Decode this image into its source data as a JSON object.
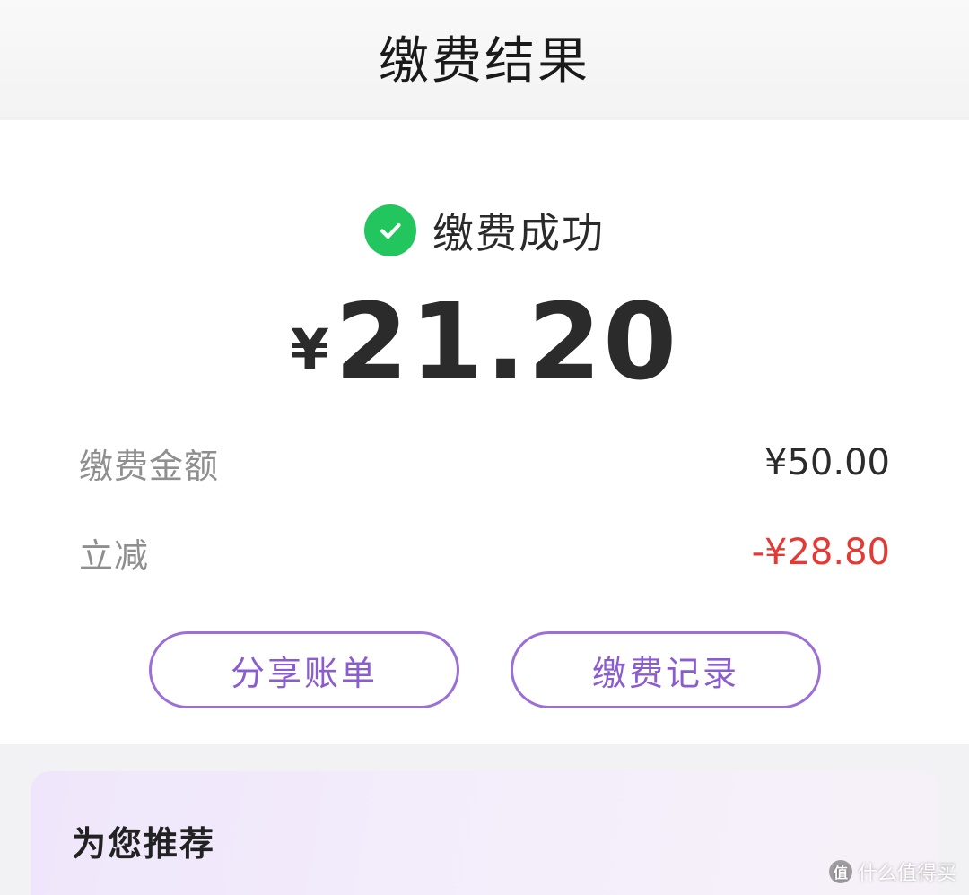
{
  "header": {
    "title": "缴费结果"
  },
  "result": {
    "status_text": "缴费成功",
    "currency_symbol": "¥",
    "paid_amount": "21.20",
    "details": [
      {
        "label": "缴费金额",
        "value": "¥50.00"
      },
      {
        "label": "立减",
        "value": "-¥28.80"
      }
    ],
    "buttons": {
      "share_label": "分享账单",
      "history_label": "缴费记录"
    }
  },
  "recommend": {
    "title": "为您推荐"
  },
  "watermark": {
    "badge": "值",
    "text": "什么值得买"
  },
  "colors": {
    "success": "#22c55e",
    "accent": "#9b6fd6",
    "discount": "#e53935"
  }
}
